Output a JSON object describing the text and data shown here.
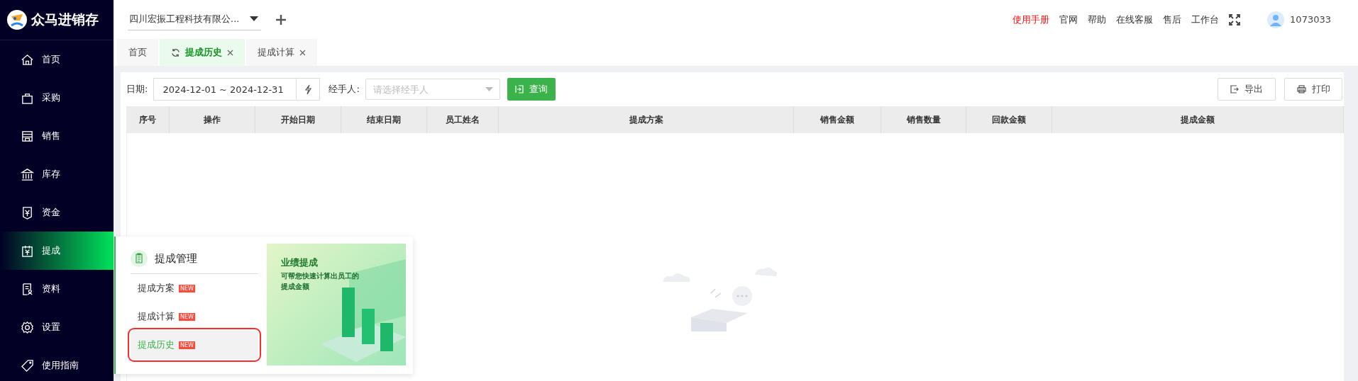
{
  "app": {
    "name": "众马进销存"
  },
  "sidebar": {
    "items": [
      {
        "label": "首页",
        "selected": false
      },
      {
        "label": "采购",
        "selected": false
      },
      {
        "label": "销售",
        "selected": false
      },
      {
        "label": "库存",
        "selected": false
      },
      {
        "label": "资金",
        "selected": false
      },
      {
        "label": "提成",
        "selected": true
      },
      {
        "label": "资料",
        "selected": false
      },
      {
        "label": "设置",
        "selected": false
      },
      {
        "label": "使用指南",
        "selected": false
      }
    ]
  },
  "topbar": {
    "company": "四川宏振工程科技有限公...",
    "links": [
      {
        "label": "使用手册",
        "highlight": true
      },
      {
        "label": "官网",
        "highlight": false
      },
      {
        "label": "帮助",
        "highlight": false
      },
      {
        "label": "在线客服",
        "highlight": false
      },
      {
        "label": "售后",
        "highlight": false
      },
      {
        "label": "工作台",
        "highlight": false
      }
    ],
    "user": "1073033"
  },
  "tabs": [
    {
      "label": "首页",
      "selected": false,
      "closable": false
    },
    {
      "label": "提成历史",
      "selected": true,
      "closable": true
    },
    {
      "label": "提成计算",
      "selected": false,
      "closable": true
    }
  ],
  "filters": {
    "date_label": "日期:",
    "date_value": "2024-12-01 ~ 2024-12-31",
    "handler_label": "经手人:",
    "handler_placeholder": "请选择经手人",
    "query_button": "查询"
  },
  "actions": [
    "导出",
    "打印"
  ],
  "table": {
    "columns": [
      "序号",
      "操作",
      "开始日期",
      "结束日期",
      "员工姓名",
      "提成方案",
      "销售金额",
      "销售数量",
      "回款金额",
      "提成金额"
    ]
  },
  "flyout": {
    "title": "提成管理",
    "items": [
      {
        "label": "提成方案",
        "badge": "NEW",
        "selected": false,
        "highlighted": false
      },
      {
        "label": "提成计算",
        "badge": "NEW",
        "selected": false,
        "highlighted": false
      },
      {
        "label": "提成历史",
        "badge": "NEW",
        "selected": true,
        "highlighted": true
      }
    ],
    "banner": {
      "title": "业绩提成",
      "text": "可帮您快速计算出员工的提成金额"
    }
  }
}
